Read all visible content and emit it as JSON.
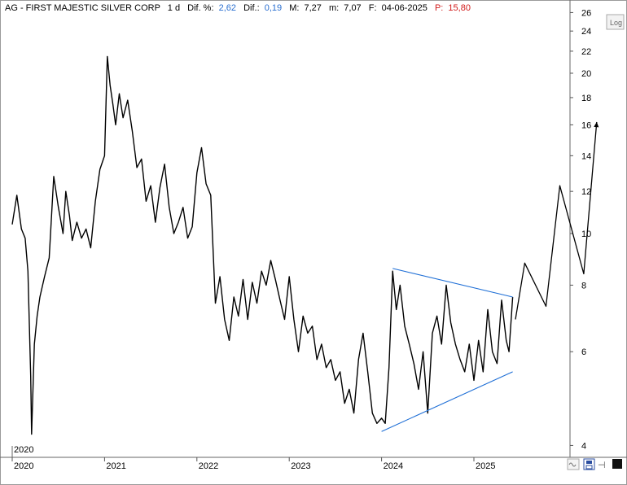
{
  "header": {
    "symbol_name": "AG - FIRST MAJESTIC SILVER CORP",
    "timeframe": "1 d",
    "dif_pct_label": "Dif. %:",
    "dif_pct_value": "2,62",
    "dif_label": "Dif.:",
    "dif_value": "0,19",
    "max_label": "M:",
    "max_value": "7,27",
    "min_label": "m:",
    "min_value": "7,07",
    "date_label": "F:",
    "date_value": "04-06-2025",
    "price_label": "P:",
    "price_value": "15,80"
  },
  "buttons": {
    "log_label": "Log"
  },
  "colors": {
    "price": "#000000",
    "trendline": "#1f6fd6",
    "axis": "#333333",
    "grid_frame": "#999999"
  },
  "chart_data": {
    "type": "line",
    "scale": "log",
    "ylim": [
      3.8,
      26.5
    ],
    "y_ticks": [
      4,
      6,
      8,
      10,
      12,
      14,
      16,
      18,
      20,
      22,
      24,
      26
    ],
    "x_ticks": [
      "2020",
      "2021",
      "2022",
      "2023",
      "2024",
      "2025"
    ],
    "xlim": [
      2020.0,
      2026.5
    ],
    "corner_label": "2020",
    "series": [
      {
        "role": "price",
        "x": [
          2020.0,
          2020.05,
          2020.1,
          2020.14,
          2020.17,
          2020.2,
          2020.21,
          2020.24,
          2020.27,
          2020.3,
          2020.35,
          2020.4,
          2020.45,
          2020.5,
          2020.55,
          2020.58,
          2020.62,
          2020.65,
          2020.7,
          2020.75,
          2020.8,
          2020.85,
          2020.9,
          2020.95,
          2021.0,
          2021.03,
          2021.06,
          2021.09,
          2021.12,
          2021.16,
          2021.2,
          2021.25,
          2021.3,
          2021.35,
          2021.4,
          2021.45,
          2021.5,
          2021.55,
          2021.6,
          2021.65,
          2021.7,
          2021.75,
          2021.8,
          2021.85,
          2021.9,
          2021.95,
          2022.0,
          2022.05,
          2022.1,
          2022.15,
          2022.2,
          2022.25,
          2022.3,
          2022.35,
          2022.4,
          2022.45,
          2022.5,
          2022.55,
          2022.6,
          2022.65,
          2022.7,
          2022.75,
          2022.8,
          2022.85,
          2022.9,
          2022.95,
          2023.0,
          2023.05,
          2023.1,
          2023.15,
          2023.2,
          2023.25,
          2023.3,
          2023.35,
          2023.4,
          2023.45,
          2023.5,
          2023.55,
          2023.6,
          2023.65,
          2023.7,
          2023.75,
          2023.8,
          2023.85,
          2023.9,
          2023.95,
          2024.0,
          2024.04,
          2024.08,
          2024.12,
          2024.16,
          2024.2,
          2024.25,
          2024.3,
          2024.35,
          2024.4,
          2024.45,
          2024.5,
          2024.55,
          2024.6,
          2024.65,
          2024.7,
          2024.75,
          2024.8,
          2024.85,
          2024.9,
          2024.95,
          2025.0,
          2025.05,
          2025.1,
          2025.15,
          2025.2,
          2025.25,
          2025.3,
          2025.35,
          2025.38,
          2025.42
        ],
        "y": [
          10.4,
          11.8,
          10.2,
          9.8,
          8.5,
          5.4,
          4.2,
          6.2,
          7.0,
          7.6,
          8.3,
          9.0,
          12.8,
          11.2,
          10.0,
          12.0,
          10.8,
          9.7,
          10.5,
          9.8,
          10.2,
          9.4,
          11.5,
          13.2,
          14.0,
          21.5,
          19.0,
          17.5,
          16.0,
          18.3,
          16.5,
          17.8,
          15.6,
          13.3,
          13.8,
          11.5,
          12.3,
          10.5,
          12.2,
          13.5,
          11.2,
          10.0,
          10.5,
          11.2,
          9.8,
          10.3,
          13.0,
          14.5,
          12.4,
          11.8,
          7.4,
          8.3,
          6.9,
          6.3,
          7.6,
          7.0,
          8.2,
          6.9,
          8.1,
          7.4,
          8.5,
          8.0,
          8.9,
          8.2,
          7.5,
          6.9,
          8.3,
          6.9,
          6.0,
          7.0,
          6.5,
          6.7,
          5.8,
          6.2,
          5.6,
          5.8,
          5.3,
          5.5,
          4.8,
          5.1,
          4.6,
          5.8,
          6.5,
          5.5,
          4.6,
          4.4,
          4.5,
          4.4,
          5.6,
          8.5,
          7.2,
          8.0,
          6.7,
          6.2,
          5.7,
          5.1,
          6.0,
          4.6,
          6.5,
          7.0,
          6.2,
          8.0,
          6.8,
          6.2,
          5.8,
          5.5,
          6.2,
          5.3,
          6.3,
          5.5,
          7.2,
          6.0,
          5.7,
          7.5,
          6.3,
          6.0,
          7.6
        ]
      },
      {
        "role": "projection",
        "x": [
          2025.45,
          2025.55,
          2025.78,
          2025.93,
          2026.19,
          2026.33
        ],
        "y": [
          6.9,
          8.8,
          7.3,
          12.3,
          8.4,
          16.2
        ]
      },
      {
        "role": "upper-trendline",
        "x": [
          2024.12,
          2025.42
        ],
        "y": [
          8.6,
          7.6
        ]
      },
      {
        "role": "lower-trendline",
        "x": [
          2024.0,
          2025.42
        ],
        "y": [
          4.25,
          5.5
        ]
      }
    ]
  }
}
